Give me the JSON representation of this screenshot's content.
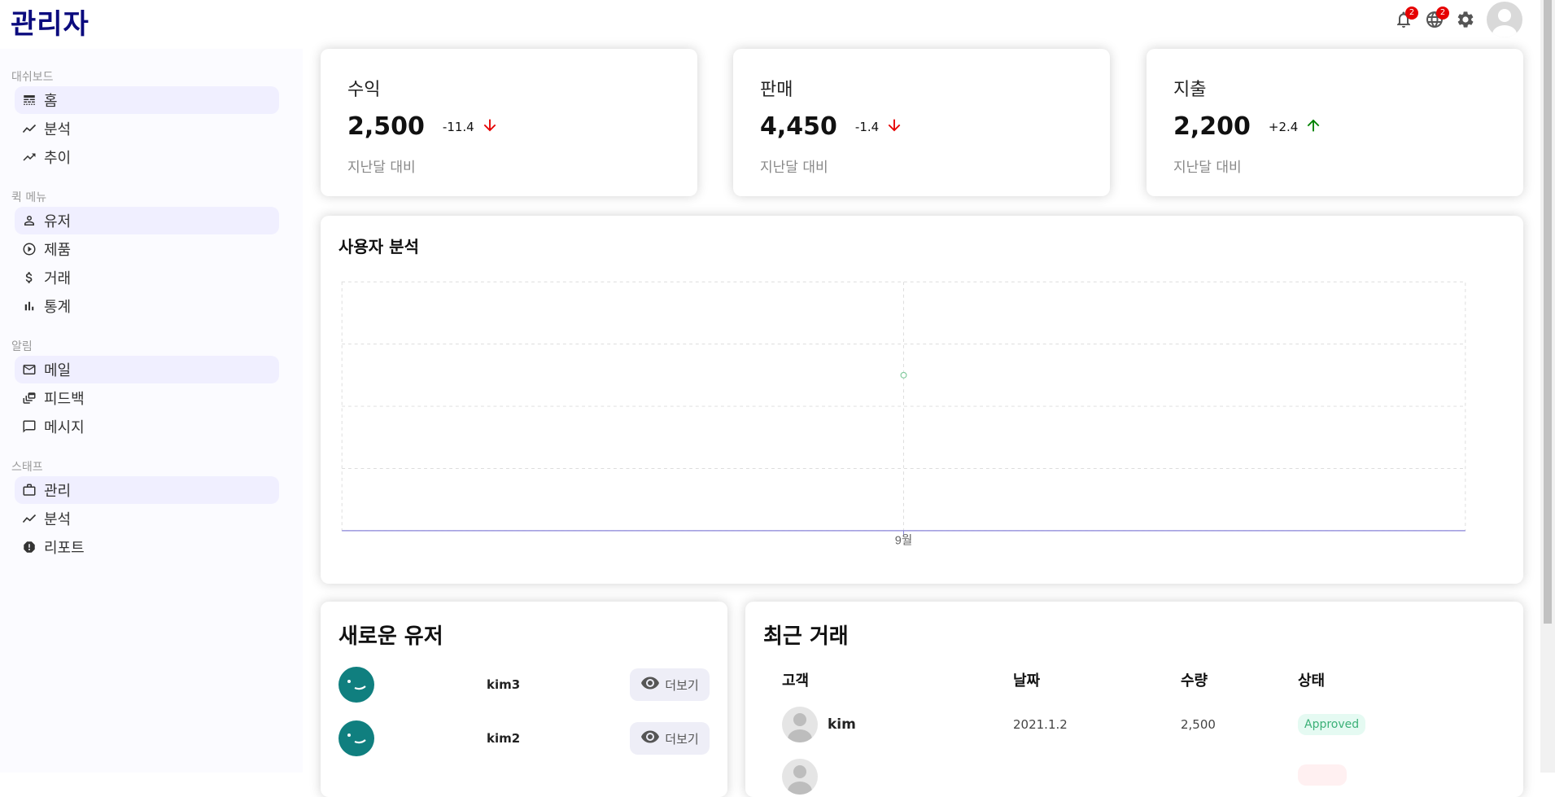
{
  "app": {
    "title": "관리자"
  },
  "topbar": {
    "notifications_badge": "2",
    "language_badge": "2",
    "icons": [
      "bell-icon",
      "globe-icon",
      "gear-icon",
      "avatar"
    ]
  },
  "sidebar": {
    "sections": [
      {
        "title": "대쉬보드",
        "items": [
          {
            "label": "홈",
            "icon": "line-style-icon",
            "active": true
          },
          {
            "label": "분석",
            "icon": "timeline-icon",
            "active": false
          },
          {
            "label": "추이",
            "icon": "trending-up-icon",
            "active": false
          }
        ]
      },
      {
        "title": "퀵 메뉴",
        "items": [
          {
            "label": "유저",
            "icon": "person-icon",
            "active": true
          },
          {
            "label": "제품",
            "icon": "play-circle-icon",
            "active": false
          },
          {
            "label": "거래",
            "icon": "dollar-icon",
            "active": false
          },
          {
            "label": "통계",
            "icon": "bar-chart-icon",
            "active": false
          }
        ]
      },
      {
        "title": "알림",
        "items": [
          {
            "label": "메일",
            "icon": "mail-icon",
            "active": true
          },
          {
            "label": "피드백",
            "icon": "dynamic-feed-icon",
            "active": false
          },
          {
            "label": "메시지",
            "icon": "chat-bubble-icon",
            "active": false
          }
        ]
      },
      {
        "title": "스태프",
        "items": [
          {
            "label": "관리",
            "icon": "briefcase-icon",
            "active": true
          },
          {
            "label": "분석",
            "icon": "timeline-icon",
            "active": false
          },
          {
            "label": "리포트",
            "icon": "report-icon",
            "active": false
          }
        ]
      }
    ]
  },
  "featured": [
    {
      "title": "수익",
      "money": "2,500",
      "rate": "-11.4",
      "direction": "down",
      "sub": "지난달 대비"
    },
    {
      "title": "판매",
      "money": "4,450",
      "rate": "-1.4",
      "direction": "down",
      "sub": "지난달 대비"
    },
    {
      "title": "지출",
      "money": "2,200",
      "rate": "+2.4",
      "direction": "up",
      "sub": "지난달 대비"
    }
  ],
  "colors": {
    "down": "#e60000",
    "up": "#008000",
    "chart_line": "#8884d8",
    "chart_dot": "#82ca9d",
    "grid": "#dddddd"
  },
  "chart_data": {
    "type": "line",
    "title": "사용자 분석",
    "categories": [
      "9월"
    ],
    "series": [
      {
        "values": [
          0
        ]
      }
    ],
    "grid": true,
    "dot_marker": true
  },
  "new_users": {
    "title": "새로운 유저",
    "button_label": "더보기",
    "items": [
      {
        "name": "kim3"
      },
      {
        "name": "kim2"
      }
    ]
  },
  "transactions": {
    "title": "최근 거래",
    "headers": [
      "고객",
      "날짜",
      "수량",
      "상태"
    ],
    "rows": [
      {
        "name": "kim",
        "date": "2021.1.2",
        "amount": "2,500",
        "status": "Approved",
        "status_type": "approved"
      },
      {
        "name": "",
        "date": "",
        "amount": "",
        "status": "",
        "status_type": "declined"
      }
    ]
  }
}
